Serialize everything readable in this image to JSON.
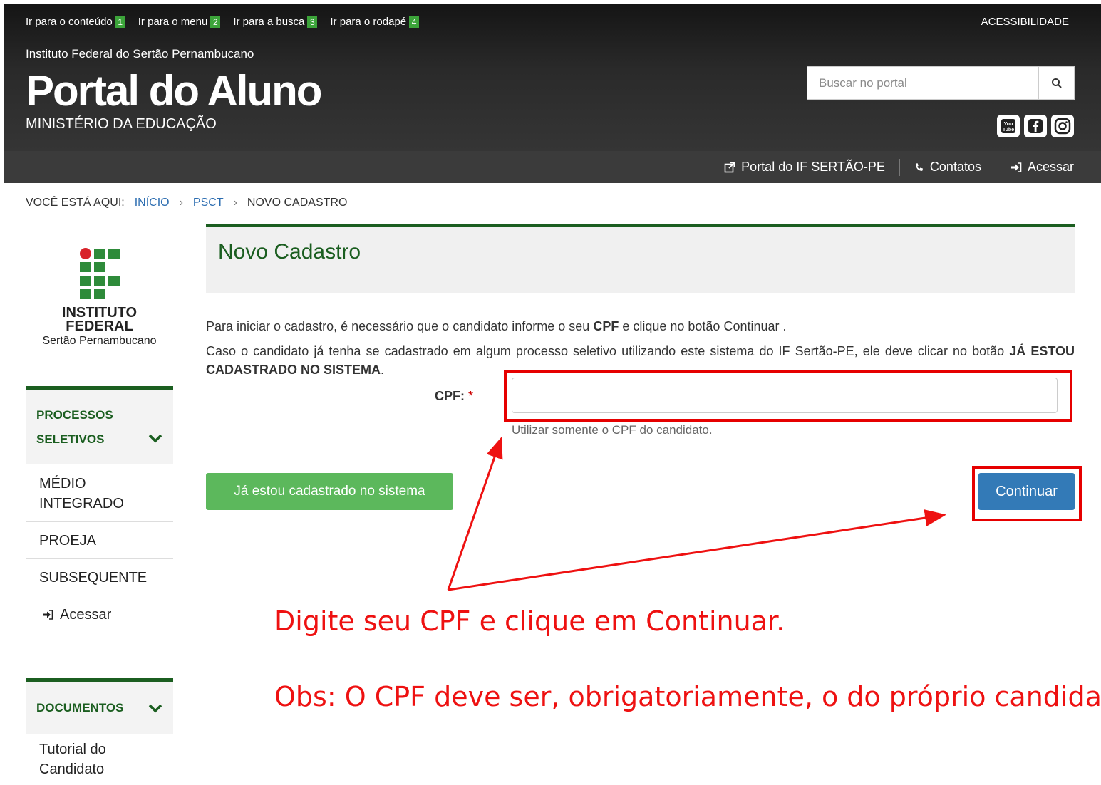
{
  "skip_links": [
    {
      "label": "Ir para o conteúdo",
      "num": "1"
    },
    {
      "label": "Ir para o menu",
      "num": "2"
    },
    {
      "label": "Ir para a busca",
      "num": "3"
    },
    {
      "label": "Ir para o rodapé",
      "num": "4"
    }
  ],
  "header": {
    "accessibility": "ACESSIBILIDADE",
    "org_name": "Instituto Federal do Sertão Pernambucano",
    "title": "Portal do Aluno",
    "ministry": "MINISTÉRIO DA EDUCAÇÃO",
    "search_placeholder": "Buscar no portal",
    "social": [
      "youtube-icon",
      "facebook-icon",
      "instagram-icon"
    ]
  },
  "topnav": {
    "portal": "Portal do IF SERTÃO-PE",
    "contacts": "Contatos",
    "login": "Acessar"
  },
  "breadcrumb": {
    "prefix": "VOCÊ ESTÁ AQUI:",
    "items": [
      "INÍCIO",
      "PSCT",
      "NOVO CADASTRO"
    ]
  },
  "logo": {
    "name_line1": "INSTITUTO",
    "name_line2": "FEDERAL",
    "sub": "Sertão Pernambucano"
  },
  "sidebar": {
    "section1_line1": "PROCESSOS",
    "section1_line2": "SELETIVOS",
    "items": [
      "MÉDIO INTEGRADO",
      "PROEJA",
      "SUBSEQUENTE",
      "Acessar"
    ],
    "section2": "DOCUMENTOS",
    "doc_items": [
      "Tutorial do Candidato"
    ]
  },
  "main": {
    "title": "Novo Cadastro",
    "para1_a": "Para iniciar o cadastro, é necessário que o candidato informe o seu ",
    "para1_b": "CPF",
    "para1_c": " e clique no botão Continuar .",
    "para2_a": "Caso o candidato já tenha se cadastrado em algum processo seletivo utilizando este sistema do IF Sertão-PE, ele deve clicar no botão ",
    "para2_b": "JÁ ESTOU CADASTRADO NO SISTEMA",
    "para2_c": ".",
    "cpf_label": "CPF:",
    "cpf_required": "*",
    "cpf_value": "",
    "cpf_help": "Utilizar somente o CPF do candidato.",
    "btn_already": "Já estou cadastrado no sistema",
    "btn_continue": "Continuar"
  },
  "annotations": {
    "line1": "Digite seu CPF e clique em Continuar.",
    "line2": "Obs: O CPF deve ser, obrigatoriamente, o do próprio candidato",
    "color": "#ee1111"
  }
}
